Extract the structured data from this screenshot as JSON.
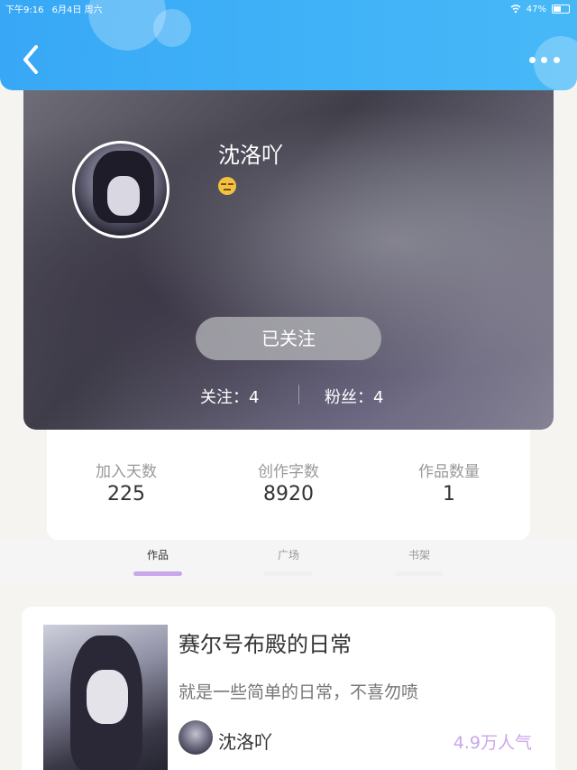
{
  "status_bar": {
    "time": "下午9:16",
    "date": "6月4日 周六",
    "battery": "47%",
    "battery_level": 0.47
  },
  "profile": {
    "name": "沈洛吖",
    "follow_button": "已关注",
    "following_label": "关注：4",
    "followers_label": "粉丝：4"
  },
  "stats": [
    {
      "label": "加入天数",
      "value": "225"
    },
    {
      "label": "创作字数",
      "value": "8920"
    },
    {
      "label": "作品数量",
      "value": "1"
    }
  ],
  "tabs": [
    {
      "label": "作品",
      "active": true
    },
    {
      "label": "广场",
      "active": false
    },
    {
      "label": "书架",
      "active": false
    }
  ],
  "work": {
    "title": "赛尔号布殿的日常",
    "description": "就是一些简单的日常，不喜勿喷",
    "author": "沈洛吖",
    "popularity": "4.9万人气"
  },
  "colors": {
    "topbar": "#3fb1f7",
    "accent": "#c9a7ea"
  },
  "icons": {
    "back": "chevron-left-icon",
    "more": "more-dots-icon",
    "wifi": "wifi-icon",
    "battery": "battery-icon",
    "emoji": "expressionless-emoji-icon"
  }
}
